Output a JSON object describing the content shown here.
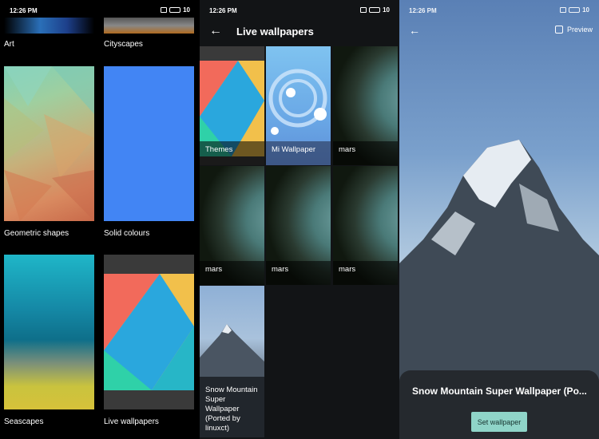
{
  "status": {
    "time": "12:26 PM",
    "battery": "10"
  },
  "panel1": {
    "categories": [
      {
        "label": "Art"
      },
      {
        "label": "Cityscapes"
      },
      {
        "label": "Geometric shapes"
      },
      {
        "label": "Solid colours"
      },
      {
        "label": "Seascapes"
      },
      {
        "label": "Live wallpapers"
      }
    ]
  },
  "panel2": {
    "title": "Live wallpapers",
    "items": [
      {
        "label": "Themes"
      },
      {
        "label": "Mi Wallpaper"
      },
      {
        "label": "mars"
      },
      {
        "label": "mars"
      },
      {
        "label": "mars"
      },
      {
        "label": "mars"
      },
      {
        "label": "Snow Mountain Super Wallpaper (Ported by linuxct)"
      }
    ]
  },
  "panel3": {
    "preview_label": "Preview",
    "wallpaper_title": "Snow Mountain Super Wallpaper (Po...",
    "set_button": "Set wallpaper"
  },
  "colors": {
    "accent": "#8fd4c8",
    "solid_tile": "#4285f4"
  }
}
